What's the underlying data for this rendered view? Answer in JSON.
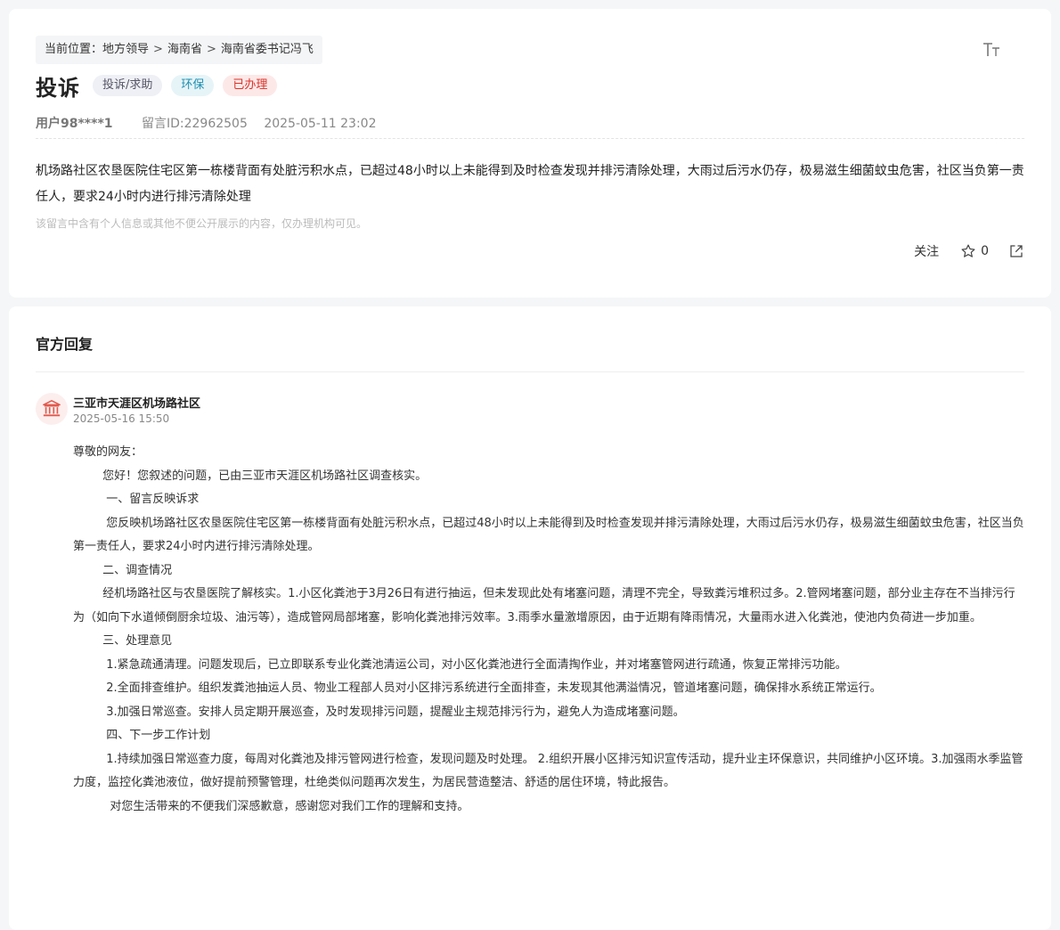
{
  "breadcrumb": {
    "prefix": "当前位置：",
    "items": [
      "地方领导",
      "海南省",
      "海南省委书记冯飞"
    ],
    "separator": ">"
  },
  "font_size_toggle": "TT",
  "message": {
    "title": "投诉",
    "tags": {
      "type": "投诉/求助",
      "topic": "环保",
      "status": "已办理"
    },
    "user": "用户98****1",
    "message_id": "留言ID:22962505",
    "time": "2025-05-11 23:02",
    "content": "机场路社区农垦医院住宅区第一栋楼背面有处脏污积水点，已超过48小时以上未能得到及时检查发现并排污清除处理，大雨过后污水仍存，极易滋生细菌蚊虫危害，社区当负第一责任人，要求24小时内进行排污清除处理",
    "privacy_notice": "该留言中含有个人信息或其他不便公开展示的内容，仅办理机构可见。"
  },
  "actions": {
    "follow_label": "关注",
    "star_count": "0"
  },
  "reply": {
    "section_title": "官方回复",
    "org_name": "三亚市天涯区机场路社区",
    "time": "2025-05-16 15:50",
    "paragraphs": [
      "尊敬的网友：",
      "        您好！您叙述的问题，已由三亚市天涯区机场路社区调查核实。",
      "         一、留言反映诉求",
      "         您反映机场路社区农垦医院住宅区第一栋楼背面有处脏污积水点，已超过48小时以上未能得到及时检查发现并排污清除处理，大雨过后污水仍存，极易滋生细菌蚊虫危害，社区当负第一责任人，要求24小时内进行排污清除处理。",
      "        二、调查情况",
      "        经机场路社区与农垦医院了解核实。1.小区化粪池于3月26日有进行抽运，但未发现此处有堵塞问题，清理不完全，导致粪污堆积过多。2.管网堵塞问题，部分业主存在不当排污行为（如向下水道倾倒厨余垃圾、油污等），造成管网局部堵塞，影响化粪池排污效率。3.雨季水量激增原因，由于近期有降雨情况，大量雨水进入化粪池，使池内负荷进一步加重。",
      "        三、处理意见",
      "         1.紧急疏通清理。问题发现后，已立即联系专业化粪池清运公司，对小区化粪池进行全面清掏作业，并对堵塞管网进行疏通，恢复正常排污功能。",
      "         2.全面排查维护。组织发粪池抽运人员、物业工程部人员对小区排污系统进行全面排查，未发现其他满溢情况，管道堵塞问题，确保排水系统正常运行。",
      "         3.加强日常巡查。安排人员定期开展巡查，及时发现排污问题，提醒业主规范排污行为，避免人为造成堵塞问题。",
      "         四、下一步工作计划",
      "         1.持续加强日常巡查力度，每周对化粪池及排污管网进行检查，发现问题及时处理。 2.组织开展小区排污知识宣传活动，提升业主环保意识，共同维护小区环境。3.加强雨水季监管力度，监控化粪池液位，做好提前预警管理，杜绝类似问题再次发生，为居民营造整洁、舒适的居住环境，特此报告。",
      "          对您生活带来的不便我们深感歉意，感谢您对我们工作的理解和支持。"
    ]
  },
  "colors": {
    "page_bg": "#f5f6f8",
    "status_tag": "#d8352b",
    "topic_tag": "#1e8fb0",
    "org_icon": "#e05a4e"
  },
  "icons": [
    "font-size-icon",
    "star-icon",
    "share-icon",
    "government-building-icon"
  ]
}
